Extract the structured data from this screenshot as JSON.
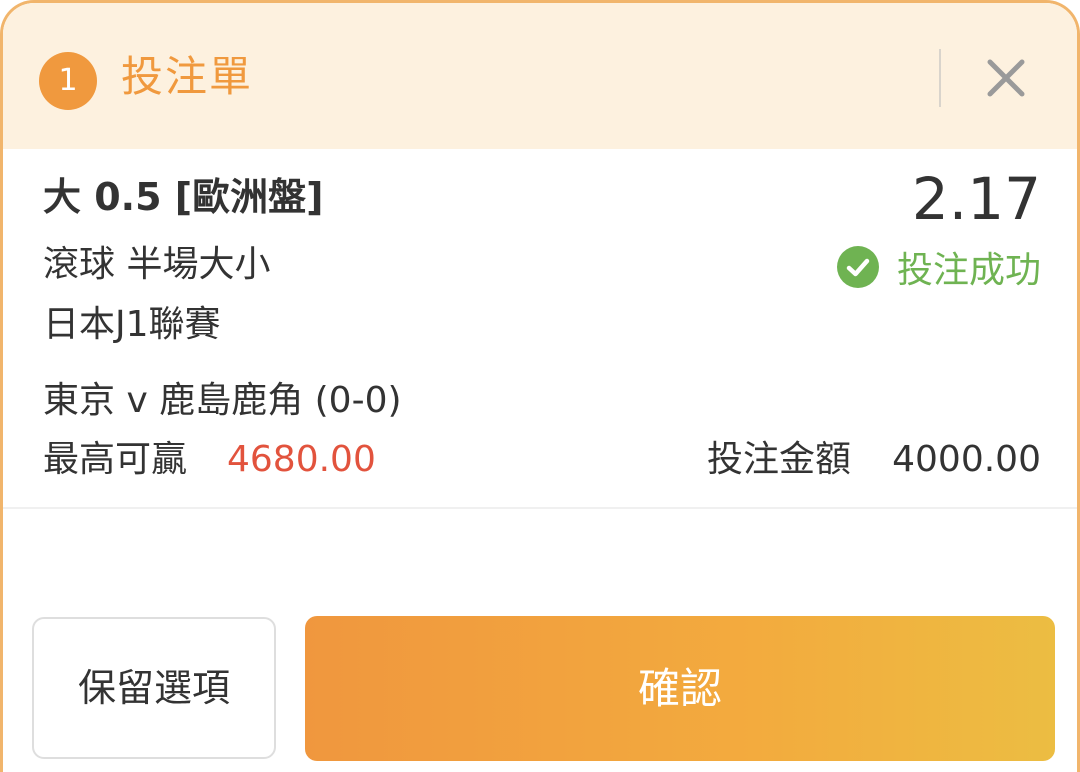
{
  "header": {
    "count": "1",
    "title": "投注單",
    "close_icon": "close-icon"
  },
  "bet": {
    "selection": "大 0.5 [歐洲盤]",
    "odds": "2.17",
    "market": "滾球 半場大小",
    "status_text": "投注成功",
    "status_icon": "check-circle-icon",
    "league": "日本J1聯賽",
    "match": "東京 v 鹿島鹿角 (0-0)",
    "potential_win_label": "最高可贏",
    "potential_win_value": "4680.00",
    "stake_label": "投注金額",
    "stake_value": "4000.00"
  },
  "footer": {
    "keep_label": "保留選項",
    "confirm_label": "確認"
  },
  "colors": {
    "accent": "#f0993e",
    "success": "#6fb352",
    "win_value": "#e2533d",
    "header_bg": "#fdf1df"
  }
}
